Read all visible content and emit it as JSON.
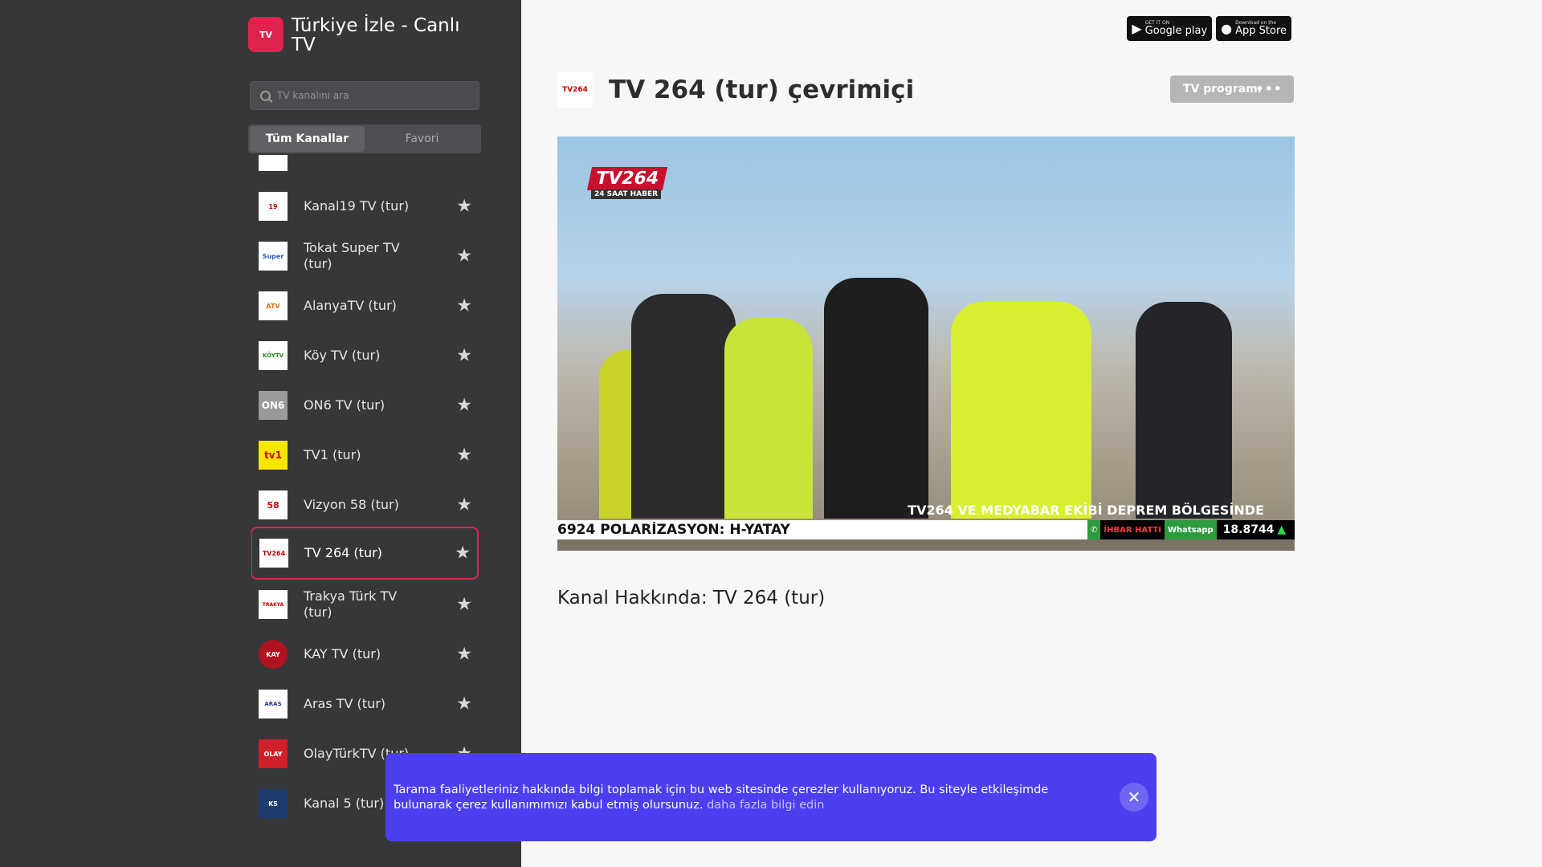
{
  "brand": {
    "title": "Türkiye İzle - Canlı TV",
    "logo_text": "TV"
  },
  "search": {
    "placeholder": "TV kanalını ara"
  },
  "tabs": [
    {
      "label": "Tüm Kanallar",
      "active": true
    },
    {
      "label": "Favori",
      "active": false
    }
  ],
  "channels": [
    {
      "name": "Kanal19 TV (tur)",
      "logo": "19"
    },
    {
      "name": "Tokat Super TV (tur)",
      "logo": "Super"
    },
    {
      "name": "AlanyaTV (tur)",
      "logo": "ATV"
    },
    {
      "name": "Köy TV (tur)",
      "logo": "KÖYTV"
    },
    {
      "name": "ON6 TV (tur)",
      "logo": "ON6"
    },
    {
      "name": "TV1 (tur)",
      "logo": "tv1"
    },
    {
      "name": "Vizyon 58 (tur)",
      "logo": "58"
    },
    {
      "name": "TV 264 (tur)",
      "logo": "TV264",
      "active": true
    },
    {
      "name": "Trakya Türk TV (tur)",
      "logo": "TRAKYA"
    },
    {
      "name": "KAY TV (tur)",
      "logo": "KAY"
    },
    {
      "name": "Aras TV (tur)",
      "logo": "ARAS"
    },
    {
      "name": "OlayTürkTV (tur)",
      "logo": "OLAY"
    },
    {
      "name": "Kanal 5 (tur)",
      "logo": "K5"
    }
  ],
  "store": {
    "google_small": "GET IT ON",
    "google_big": "Google play",
    "apple_small": "Download on the",
    "apple_big": "App Store"
  },
  "main": {
    "title": "TV 264 (tur) çevrimiçi",
    "header_logo": "TV264",
    "tv_program_label": "TV programı",
    "tv_program_dots": "•••",
    "about": "Kanal Hakkında: TV 264 (tur)"
  },
  "player": {
    "logo": "TV264",
    "logo_sub": "24 SAAT HABER",
    "headline": "TV264 VE MEDYABAR EKİBİ DEPREM BÖLGESİNDE",
    "ticker": "6924 POLARİZASYON: H-YATAY",
    "ihbar": "İHBAR HATTI",
    "whatsapp": "Whatsapp",
    "value": "18.8744"
  },
  "cookie": {
    "text": "Tarama faaliyetleriniz hakkında bilgi toplamak için bu web sitesinde çerezler kullanıyoruz. Bu siteyle etkileşimde bulunarak çerez kullanımımızı kabul etmiş olursunuz.",
    "link": "daha fazla bilgi edin",
    "close": "✕"
  },
  "colors": {
    "sidebar_bg": "#353739",
    "accent": "#e0224d",
    "cookie_bg": "#4b3fef",
    "page_bg": "#f8f7f5"
  }
}
